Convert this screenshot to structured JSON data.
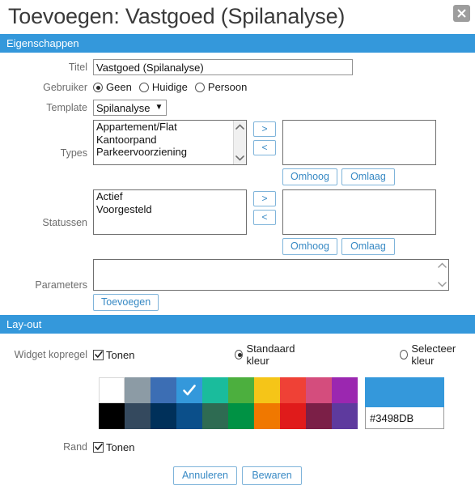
{
  "dialog": {
    "title": "Toevoegen: Vastgoed (Spilanalyse)",
    "close_icon": "close-icon"
  },
  "sections": {
    "properties_header": "Eigenschappen",
    "layout_header": "Lay-out"
  },
  "properties": {
    "titel": {
      "label": "Titel",
      "value": "Vastgoed (Spilanalyse)"
    },
    "gebruiker": {
      "label": "Gebruiker",
      "options": [
        {
          "label": "Geen",
          "checked": true
        },
        {
          "label": "Huidige",
          "checked": false
        },
        {
          "label": "Persoon",
          "checked": false
        }
      ]
    },
    "template": {
      "label": "Template",
      "value": "Spilanalyse",
      "chevron": "▼"
    },
    "types": {
      "label": "Types",
      "available": [
        "Appartement/Flat",
        "Kantoorpand",
        "Parkeervoorziening"
      ],
      "selected": [],
      "add_button": ">",
      "remove_button": "<",
      "move_up": "Omhoog",
      "move_down": "Omlaag"
    },
    "statussen": {
      "label": "Statussen",
      "available": [
        "Actief",
        "Voorgesteld"
      ],
      "selected": [],
      "add_button": ">",
      "remove_button": "<",
      "move_up": "Omhoog",
      "move_down": "Omlaag"
    },
    "parameters": {
      "label": "Parameters",
      "items": [],
      "add_button": "Toevoegen"
    }
  },
  "layout": {
    "widget_header": {
      "label": "Widget kopregel",
      "show_checkbox": {
        "label": "Tonen",
        "checked": true
      },
      "color_mode": [
        {
          "label": "Standaard kleur",
          "checked": true
        },
        {
          "label": "Selecteer kleur",
          "checked": false
        }
      ]
    },
    "palette": {
      "row1": [
        "#FFFFFF",
        "#8C9BA5",
        "#3C6EB4",
        "#3498DB",
        "#1ABC9C",
        "#4CAF3E",
        "#F5C518",
        "#EF4136",
        "#D44D7D",
        "#9B27B0"
      ],
      "row2": [
        "#000000",
        "#34495E",
        "#00305A",
        "#0B4F8A",
        "#2E6B52",
        "#009244",
        "#F07800",
        "#E01B1B",
        "#7B1F47",
        "#5E3A9E"
      ],
      "selected_index": 3,
      "selected_row": 1,
      "check_icon": "check-icon"
    },
    "color_preview": "#3498DB",
    "hex_value": "#3498DB",
    "rand": {
      "label": "Rand",
      "checkbox": {
        "label": "Tonen",
        "checked": true
      }
    }
  },
  "footer": {
    "cancel": "Annuleren",
    "save": "Bewaren"
  }
}
